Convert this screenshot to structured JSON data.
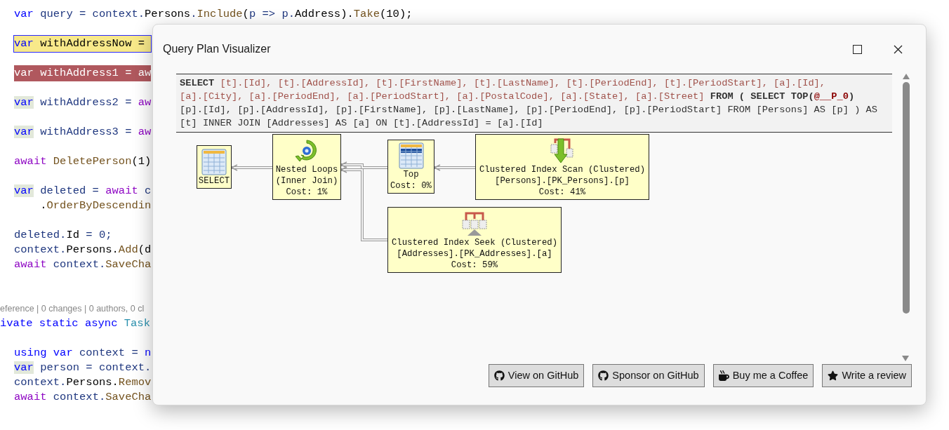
{
  "editor": {
    "lines": [
      {
        "kind": "code",
        "tokens": [
          {
            "kind": "kw",
            "text": "var"
          },
          {
            "kind": "id",
            "text": " query = context."
          },
          {
            "kind": "pl",
            "text": "Persons"
          },
          {
            "kind": "id",
            "text": "."
          },
          {
            "kind": "me",
            "text": "Include"
          },
          {
            "kind": "pl",
            "text": "("
          },
          {
            "kind": "id",
            "text": "p => p."
          },
          {
            "kind": "pl",
            "text": "Address"
          },
          {
            "kind": "pl",
            "text": ")."
          },
          {
            "kind": "me",
            "text": "Take"
          },
          {
            "kind": "pl",
            "text": "(10);"
          }
        ]
      },
      {
        "kind": "blank"
      },
      {
        "kind": "current",
        "tokens": [
          {
            "kind": "kw",
            "text": "var"
          },
          {
            "kind": "pl",
            "text": " withAddressNow = "
          }
        ]
      },
      {
        "kind": "blank"
      },
      {
        "kind": "breakpoint",
        "text": "var withAddress1 = aw"
      },
      {
        "kind": "blank"
      },
      {
        "kind": "code",
        "tokens": [
          {
            "kind": "hl",
            "text": "var"
          },
          {
            "kind": "id",
            "text": " withAddress2 = "
          },
          {
            "kind": "ctl",
            "text": "aw"
          }
        ]
      },
      {
        "kind": "blank"
      },
      {
        "kind": "code",
        "tokens": [
          {
            "kind": "hl",
            "text": "var"
          },
          {
            "kind": "id",
            "text": " withAddress3 = "
          },
          {
            "kind": "ctl",
            "text": "aw"
          }
        ]
      },
      {
        "kind": "blank"
      },
      {
        "kind": "code",
        "tokens": [
          {
            "kind": "ctl",
            "text": "await"
          },
          {
            "kind": "me",
            "text": " DeletePerson"
          },
          {
            "kind": "pl",
            "text": "(1)"
          }
        ]
      },
      {
        "kind": "blank"
      },
      {
        "kind": "code",
        "tokens": [
          {
            "kind": "hl",
            "text": "var"
          },
          {
            "kind": "id",
            "text": " deleted = "
          },
          {
            "kind": "ctl",
            "text": "await"
          },
          {
            "kind": "id",
            "text": " c"
          }
        ]
      },
      {
        "kind": "code",
        "tokens": [
          {
            "kind": "pl",
            "text": "    ."
          },
          {
            "kind": "me",
            "text": "OrderByDescendin"
          }
        ]
      },
      {
        "kind": "blank"
      },
      {
        "kind": "code",
        "tokens": [
          {
            "kind": "id",
            "text": "deleted."
          },
          {
            "kind": "pl",
            "text": "Id"
          },
          {
            "kind": "id",
            "text": " = 0;"
          }
        ]
      },
      {
        "kind": "code",
        "tokens": [
          {
            "kind": "id",
            "text": "context."
          },
          {
            "kind": "pl",
            "text": "Persons."
          },
          {
            "kind": "me",
            "text": "Add"
          },
          {
            "kind": "pl",
            "text": "(d"
          }
        ]
      },
      {
        "kind": "code",
        "tokens": [
          {
            "kind": "ctl",
            "text": "await"
          },
          {
            "kind": "id",
            "text": " context."
          },
          {
            "kind": "me",
            "text": "SaveCha"
          }
        ]
      },
      {
        "kind": "blank"
      },
      {
        "kind": "blank"
      },
      {
        "kind": "codelens",
        "text": "eference | 0 changes | 0 authors, 0 cl"
      },
      {
        "kind": "cut_left",
        "tokens": [
          {
            "kind": "kw",
            "text": "ivate static async "
          },
          {
            "kind": "ty",
            "text": "Task"
          }
        ]
      },
      {
        "kind": "blank"
      },
      {
        "kind": "code",
        "tokens": [
          {
            "kind": "kw",
            "text": "using var "
          },
          {
            "kind": "id",
            "text": "context = "
          },
          {
            "kind": "kw",
            "text": "n"
          }
        ]
      },
      {
        "kind": "code",
        "tokens": [
          {
            "kind": "hl",
            "text": "var"
          },
          {
            "kind": "id",
            "text": " person = context."
          }
        ]
      },
      {
        "kind": "code",
        "tokens": [
          {
            "kind": "id",
            "text": "context."
          },
          {
            "kind": "pl",
            "text": "Persons."
          },
          {
            "kind": "me",
            "text": "Remov"
          }
        ]
      },
      {
        "kind": "code",
        "tokens": [
          {
            "kind": "ctl",
            "text": "await"
          },
          {
            "kind": "id",
            "text": " context."
          },
          {
            "kind": "me",
            "text": "SaveCha"
          }
        ]
      }
    ]
  },
  "dialog": {
    "title": "Query Plan Visualizer",
    "sql": [
      {
        "kind": "kw",
        "text": "SELECT "
      },
      {
        "kind": "id",
        "text": "[t].[Id], [t].[AddressId], [t].[FirstName], [t].[LastName], [t].[PeriodEnd], [t].[PeriodStart], [a].[Id], [a].[City], [a].[PeriodEnd], [a].[PeriodStart], [a].[PostalCode], [a].[State], [a].[Street]"
      },
      {
        "kind": "kw",
        "text": " FROM ( SELECT TOP("
      },
      {
        "kind": "param",
        "text": "@__P_0"
      },
      {
        "kind": "kw",
        "text": ")"
      },
      {
        "kind": "pl",
        "text": " [p].[Id], [p].[AddressId], [p].[FirstName], [p].[LastName], [p].[PeriodEnd], [p].[PeriodStart] FROM [Persons] AS [p] ) AS [t] INNER JOIN [Addresses] AS [a] ON [t].[AddressId] = [a].[Id]"
      }
    ],
    "plan": {
      "nodes": [
        {
          "kind": "select",
          "lines": [
            "SELECT"
          ]
        },
        {
          "kind": "loops",
          "lines": [
            "Nested Loops",
            "(Inner Join)",
            "Cost: 1%"
          ]
        },
        {
          "kind": "top",
          "lines": [
            "Top",
            "Cost: 0%"
          ]
        },
        {
          "kind": "scan",
          "lines": [
            "Clustered Index Scan (Clustered)",
            "[Persons].[PK_Persons].[p]",
            "Cost: 41%"
          ]
        },
        {
          "kind": "seek",
          "lines": [
            "Clustered Index Seek (Clustered)",
            "[Addresses].[PK_Addresses].[a]",
            "Cost: 59%"
          ]
        }
      ]
    },
    "buttons": [
      {
        "label": "View on GitHub",
        "kind": "github"
      },
      {
        "label": "Sponsor on GitHub",
        "kind": "github"
      },
      {
        "label": "Buy me a Coffee",
        "kind": "coffee"
      },
      {
        "label": "Write a review",
        "kind": "review"
      }
    ]
  }
}
